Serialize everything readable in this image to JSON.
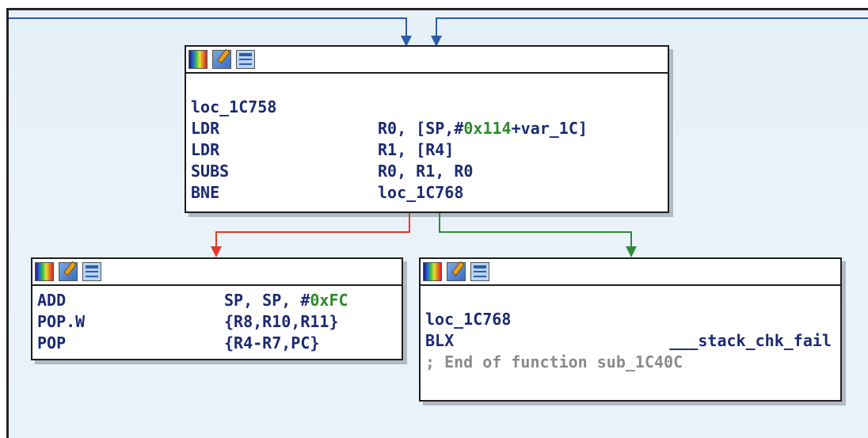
{
  "colors": {
    "canvas_bg": "#e6f0f8",
    "asm_text": "#1b2a72",
    "immediate": "#2d8a2d",
    "comment": "#8a8a8a",
    "edge_entry": "#2b5ea8",
    "edge_false": "#e03a2a",
    "edge_true": "#2f8a3a"
  },
  "toolbar_icons": [
    "color-palette-icon",
    "rename-icon",
    "graph-overview-icon"
  ],
  "blocks": {
    "top": {
      "label": "loc_1C758",
      "lines": [
        {
          "mnemonic": "LDR",
          "operands": "R0, [SP,#",
          "immediate": "0x114",
          "operands_tail": "+var_1C]"
        },
        {
          "mnemonic": "LDR",
          "operands": "R1, [R4]"
        },
        {
          "mnemonic": "SUBS",
          "operands": "R0, R1, R0"
        },
        {
          "mnemonic": "BNE",
          "operands": "loc_1C768"
        }
      ]
    },
    "left": {
      "lines": [
        {
          "mnemonic": "ADD",
          "operands": "SP, SP, #",
          "immediate": "0xFC"
        },
        {
          "mnemonic": "POP.W",
          "operands": "{R8,R10,R11}"
        },
        {
          "mnemonic": "POP",
          "operands": "{R4-R7,PC}"
        }
      ]
    },
    "right": {
      "label": "loc_1C768",
      "lines": [
        {
          "mnemonic": "BLX",
          "operands": "      ___stack_chk_fail"
        }
      ],
      "comment": "; End of function sub_1C40C"
    }
  }
}
